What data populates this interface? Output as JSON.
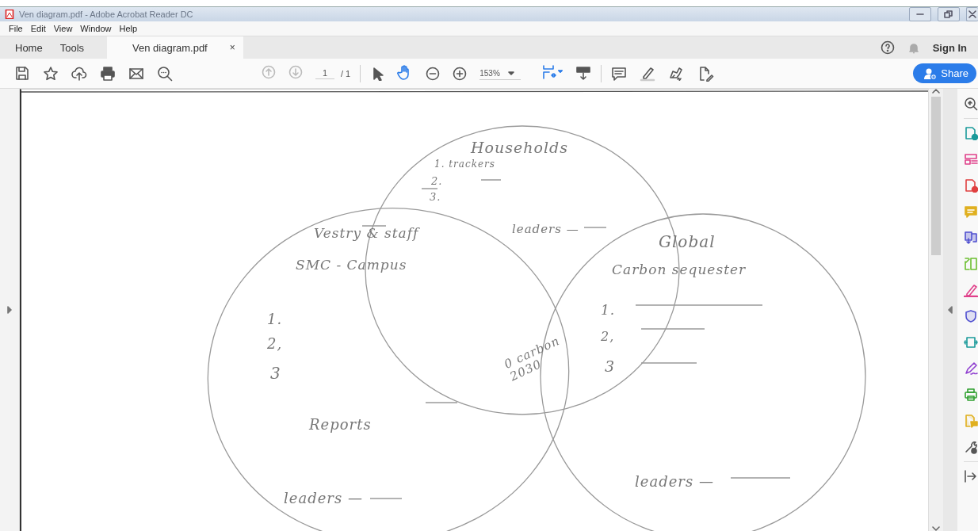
{
  "window": {
    "title": "Ven diagram.pdf - Adobe Acrobat Reader DC"
  },
  "menu": [
    "File",
    "Edit",
    "View",
    "Window",
    "Help"
  ],
  "tabs": [
    {
      "label": "Home",
      "selected": false
    },
    {
      "label": "Tools",
      "selected": false
    },
    {
      "label": "Ven diagram.pdf",
      "selected": true,
      "close": "×"
    }
  ],
  "account": {
    "sign_in": "Sign In"
  },
  "toolbar": {
    "page": "1",
    "page_total": "/ 1",
    "zoom": "153%",
    "share": "Share"
  },
  "document": {
    "notes": [
      {
        "text": "Households"
      },
      {
        "text": "1. trackers"
      },
      {
        "text": "2."
      },
      {
        "text": "3."
      },
      {
        "text": "leaders —"
      },
      {
        "text": "Vestry & staff"
      },
      {
        "text": "SMC - Campus"
      },
      {
        "text": "Global"
      },
      {
        "text": "Carbon sequester"
      },
      {
        "text": "1."
      },
      {
        "text": "2,"
      },
      {
        "text": "3"
      },
      {
        "text": "1."
      },
      {
        "text": "2,"
      },
      {
        "text": "3"
      },
      {
        "text": "0 carbon 2030"
      },
      {
        "text": "Reports"
      },
      {
        "text": "leaders —"
      },
      {
        "text": "leaders —"
      }
    ]
  }
}
